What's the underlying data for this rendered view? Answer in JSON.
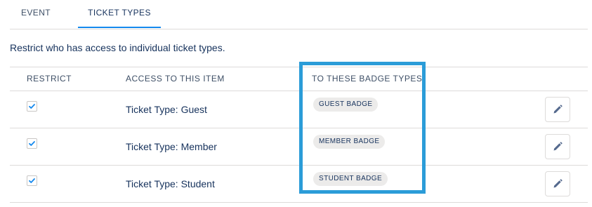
{
  "tabs": [
    {
      "label": "EVENT",
      "active": false
    },
    {
      "label": "TICKET TYPES",
      "active": true
    }
  ],
  "description": "Restrict who has access to individual ticket types.",
  "table": {
    "headers": {
      "restrict": "RESTRICT",
      "access": "ACCESS TO THIS ITEM",
      "badge_types": "TO THESE BADGE TYPES"
    },
    "rows": [
      {
        "restricted": true,
        "item": "Ticket Type: Guest",
        "badge": "GUEST BADGE"
      },
      {
        "restricted": true,
        "item": "Ticket Type: Member",
        "badge": "MEMBER BADGE"
      },
      {
        "restricted": true,
        "item": "Ticket Type: Student",
        "badge": "STUDENT BADGE"
      }
    ]
  },
  "icons": {
    "checkbox": "check-icon",
    "edit": "pencil-icon"
  },
  "colors": {
    "accent": "#1589ee",
    "highlight": "#2b9cd8",
    "text": "#16325c",
    "badge_bg": "#ecebea"
  }
}
